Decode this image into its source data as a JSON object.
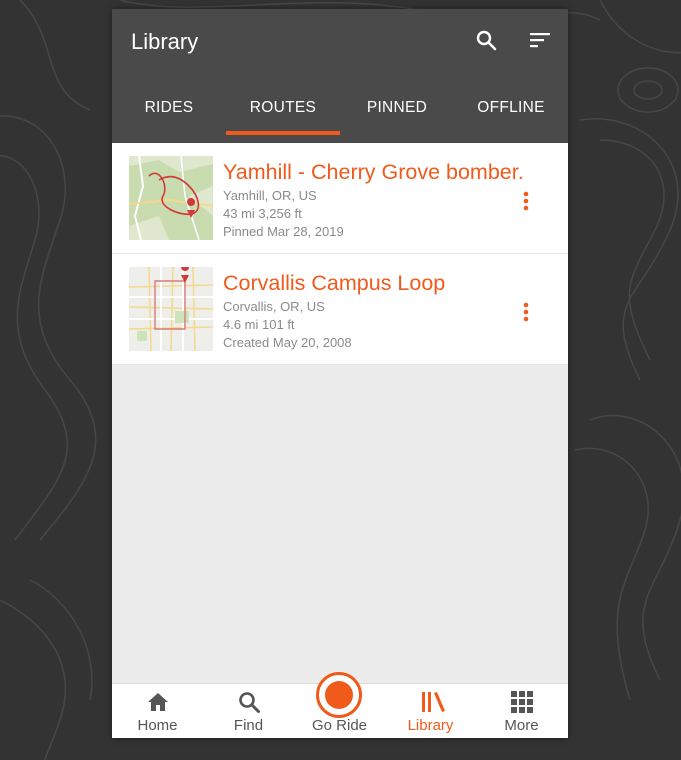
{
  "appbar": {
    "title": "Library",
    "icons": [
      "search-icon",
      "sort-icon"
    ]
  },
  "tabs": [
    {
      "label": "RIDES",
      "active": false
    },
    {
      "label": "ROUTES",
      "active": true
    },
    {
      "label": "PINNED",
      "active": false
    },
    {
      "label": "OFFLINE",
      "active": false
    }
  ],
  "routes": [
    {
      "name": "Yamhill - Cherry Grove bomber.",
      "location": "Yamhill, OR, US",
      "stats": "43 mi   3,256 ft",
      "date": "Pinned Mar 28, 2019"
    },
    {
      "name": "Corvallis Campus Loop",
      "location": "Corvallis, OR, US",
      "stats": "4.6 mi   101 ft",
      "date": "Created May 20, 2008"
    }
  ],
  "nav": {
    "home": "Home",
    "find": "Find",
    "go_ride": "Go Ride",
    "library": "Library",
    "more": "More"
  },
  "colors": {
    "accent": "#f05a1a",
    "appbar": "#4a4a4a",
    "background": "#333333"
  }
}
